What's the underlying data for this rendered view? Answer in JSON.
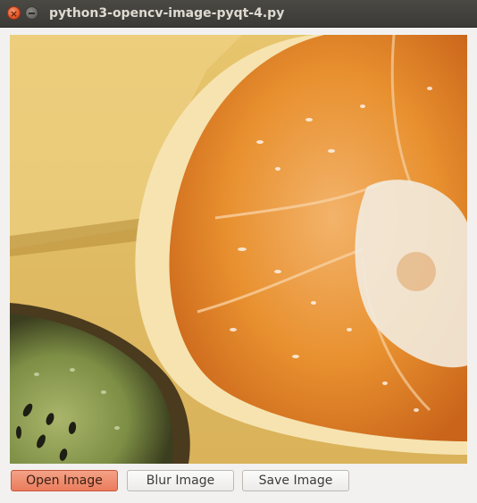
{
  "window": {
    "title": "python3-opencv-image-pyqt-4.py",
    "close_symbol": "×"
  },
  "buttons": {
    "open_label": "Open Image",
    "blur_label": "Blur Image",
    "save_label": "Save Image"
  },
  "colors": {
    "titlebar": "#3f3e3a",
    "primary_button": "#ea7c5c",
    "background": "#f2f1f0"
  },
  "icons": {
    "close": "close-icon",
    "minimize": "minimize-icon"
  }
}
